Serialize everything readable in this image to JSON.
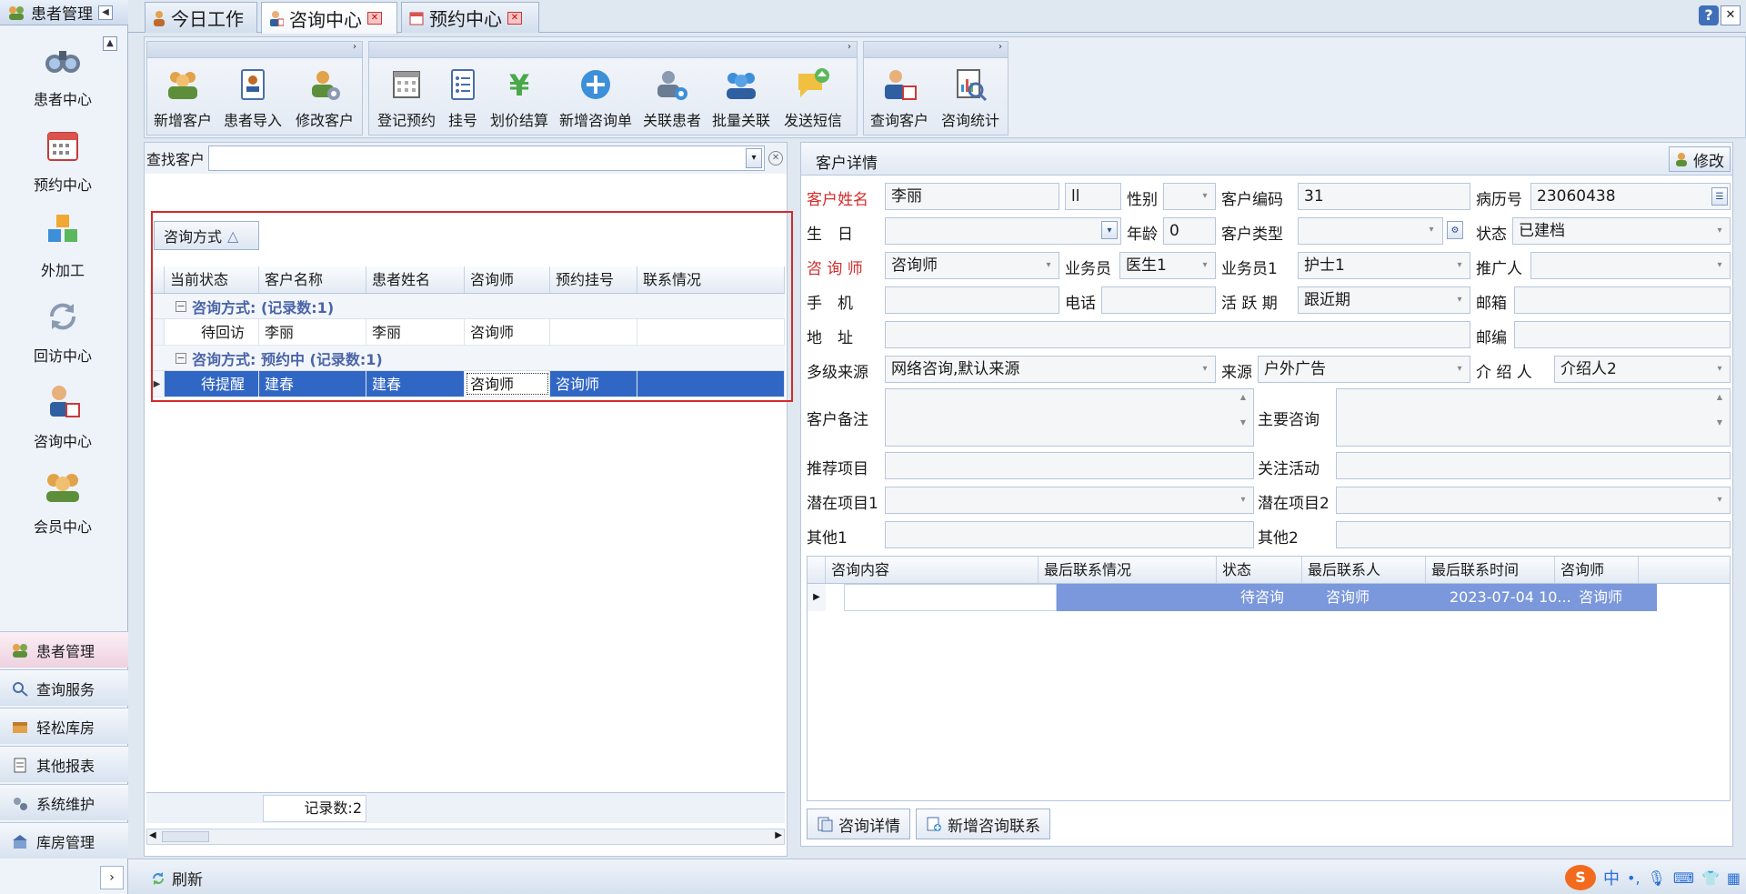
{
  "sidebar": {
    "title": "患者管理",
    "items": [
      {
        "label": "患者中心",
        "icon": "binoculars-icon"
      },
      {
        "label": "预约中心",
        "icon": "calendar-icon"
      },
      {
        "label": "外加工",
        "icon": "cubes-icon"
      },
      {
        "label": "回访中心",
        "icon": "refresh-icon"
      },
      {
        "label": "咨询中心",
        "icon": "consultant-icon"
      },
      {
        "label": "会员中心",
        "icon": "members-icon"
      }
    ],
    "groups": [
      {
        "label": "患者管理",
        "icon": "people-icon",
        "active": true
      },
      {
        "label": "查询服务",
        "icon": "query-icon"
      },
      {
        "label": "轻松库房",
        "icon": "box-icon"
      },
      {
        "label": "其他报表",
        "icon": "report-icon"
      },
      {
        "label": "系统维护",
        "icon": "tools-icon"
      },
      {
        "label": "库房管理",
        "icon": "warehouse-icon"
      }
    ]
  },
  "tabs": [
    {
      "label": "今日工作",
      "icon": "person-icon",
      "closable": false
    },
    {
      "label": "咨询中心",
      "icon": "consultant-icon",
      "closable": true,
      "active": true
    },
    {
      "label": "预约中心",
      "icon": "calendar-icon",
      "closable": true
    }
  ],
  "ribbon": {
    "groups": [
      {
        "buttons": [
          "新增客户",
          "患者导入",
          "修改客户"
        ]
      },
      {
        "buttons": [
          "登记预约",
          "挂号",
          "划价结算",
          "新增咨询单",
          "关联患者",
          "批量关联",
          "发送短信"
        ]
      },
      {
        "buttons": [
          "查询客户",
          "咨询统计"
        ]
      }
    ]
  },
  "left": {
    "search_label": "查找客户",
    "group_chip": "咨询方式",
    "columns": [
      "当前状态",
      "客户名称",
      "患者姓名",
      "咨询师",
      "预约挂号",
      "联系情况"
    ],
    "groups": [
      {
        "title": "咨询方式: (记录数:1)",
        "rows": [
          [
            "待回访",
            "李丽",
            "李丽",
            "咨询师",
            "",
            ""
          ]
        ]
      },
      {
        "title": "咨询方式: 预约中 (记录数:1)",
        "rows": [
          [
            "待提醒",
            "建春",
            "建春",
            "咨询师",
            "咨询师",
            ""
          ]
        ]
      }
    ],
    "record_count": "记录数:2"
  },
  "right": {
    "title": "客户详情",
    "edit_button": "修改",
    "fields": {
      "name_label": "客户姓名",
      "name": "李丽",
      "name_extra": "ll",
      "gender_label": "性别",
      "gender": "",
      "code_label": "客户编码",
      "code": "31",
      "record_label": "病历号",
      "record": "23060438",
      "birthday_label": "生　日",
      "birthday": "",
      "age_label": "年龄",
      "age": "0",
      "type_label": "客户类型",
      "type": "",
      "status_label": "状态",
      "status": "已建档",
      "consultant_label": "咨 询 师",
      "consultant": "咨询师",
      "staff_label": "业务员",
      "staff": "医生1",
      "staff1_label": "业务员1",
      "staff1": "护士1",
      "referrer_label": "推广人",
      "referrer": "",
      "mobile_label": "手　机",
      "mobile": "",
      "phone_label": "电话",
      "phone": "",
      "active_label": "活 跃 期",
      "active": "跟近期",
      "email_label": "邮箱",
      "email": "",
      "address_label": "地　址",
      "address": "",
      "zip_label": "邮编",
      "zip": "",
      "source_label": "多级来源",
      "source": "网络咨询,默认来源",
      "from_label": "来源",
      "from": "户外广告",
      "introducer_label": "介 绍 人",
      "introducer": "介绍人2",
      "remark_label": "客户备注",
      "main_consult_label": "主要咨询",
      "recommend_label": "推荐项目",
      "focus_label": "关注活动",
      "potential1_label": "潜在项目1",
      "potential2_label": "潜在项目2",
      "other1_label": "其他1",
      "other2_label": "其他2"
    },
    "grid": {
      "columns": [
        "咨询内容",
        "最后联系情况",
        "状态",
        "最后联系人",
        "最后联系时间",
        "咨询师"
      ],
      "rows": [
        [
          "",
          "",
          "待咨询",
          "咨询师",
          "2023-07-04 10...",
          "咨询师"
        ]
      ]
    },
    "buttons": [
      "咨询详情",
      "新增咨询联系"
    ]
  },
  "statusbar": {
    "refresh": "刷新"
  }
}
